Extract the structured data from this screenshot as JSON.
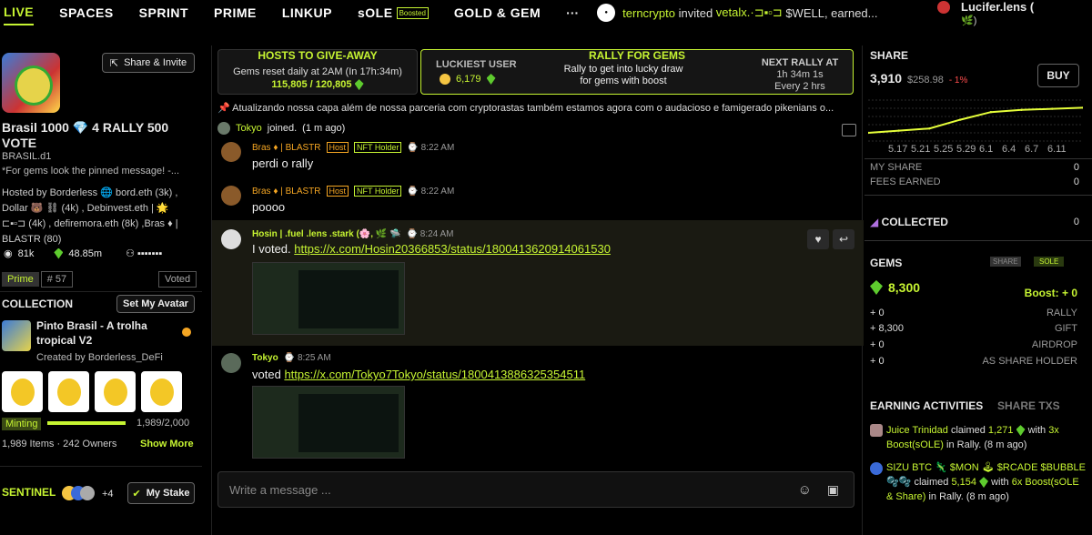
{
  "nav": {
    "tabs": [
      "LIVE",
      "SPACES",
      "SPRINT",
      "PRIME",
      "LINKUP",
      "sOLE",
      "GOLD & GEM"
    ],
    "boosted": "Boosted",
    "more": "···",
    "ticker_user": "terncrypto",
    "ticker_text": "invited",
    "ticker_target": "vetalx.·⊐▪▫⊐",
    "ticker_tail": "$WELL, earned...",
    "account_name": "Lucifer.lens (",
    "account_sub": "🌿)"
  },
  "room": {
    "share_invite": "Share & Invite",
    "title": "Brasil 1000 💎 4 RALLY 500 VOTE",
    "handle": "BRASIL.d1",
    "pinned": "*For gems look the pinned message! -...",
    "hosted_by": "Hosted by Borderless 🌐 bord.eth (3k) , Dollar 🐻 ⛓ (4k) , Debinvest.eth | 🌟 ⊏▪▫⊐ (4k) , defiremora.eth (8k) ,Bras ♦ | BLASTR (80)",
    "stat_members": "81k",
    "stat_gems": "48.85m",
    "prime": "Prime",
    "prime_rank": "# 57",
    "voted": "Voted"
  },
  "collection": {
    "heading": "COLLECTION",
    "set_avatar": "Set My Avatar",
    "name": "Pinto Brasil - A trolha tropical V2",
    "created_by": "Created by Borderless_DeFi",
    "minting": "Minting",
    "minted": "1,989/2,000",
    "progress": 0.9945,
    "items": "1,989",
    "items_label": "Items ·",
    "owners": "242",
    "owners_label": "Owners",
    "show_more": "Show More"
  },
  "sentinel": {
    "label": "SENTINEL",
    "count": "+4",
    "stake": "My Stake"
  },
  "banner": {
    "hosts_title": "HOSTS TO GIVE-AWAY",
    "hosts_reset": "Gems reset daily at 2AM (In 17h:34m)",
    "hosts_progress": "115,805 / 120,805",
    "luckiest_title": "LUCKIEST USER",
    "luckiest_value": "6,179",
    "rally_title": "RALLY FOR GEMS",
    "rally_text": "Rally to get into lucky draw for gems with boost",
    "next_rally_title": "NEXT RALLY AT",
    "next_rally_time": "1h 34m 1s",
    "next_rally_every": "Every 2 hrs"
  },
  "announcement": "Atualizando nossa capa além de nossa parceria com cryptorastas também estamos agora com o audacioso e famigerado pikenians o...",
  "joined": {
    "name": "Tokyo",
    "text": "joined.",
    "time": "(1 m ago)"
  },
  "messages": [
    {
      "name": "Bras ♦ | BLASTR",
      "host": "Host",
      "holder": "NFT Holder",
      "time": "8:22 AM",
      "text": "perdi o rally"
    },
    {
      "name": "Bras ♦ | BLASTR",
      "host": "Host",
      "holder": "NFT Holder",
      "time": "8:22 AM",
      "text": "poooo"
    },
    {
      "name": "Hosin | .fuel .lens .stark (🌸, 🌿 🛸",
      "time": "8:24 AM",
      "text": "I voted.",
      "link": "https://x.com/Hosin20366853/status/1800413620914061530"
    },
    {
      "name": "Tokyo",
      "time": "8:25 AM",
      "text": "voted",
      "link": "https://x.com/Tokyo7Tokyo/status/1800413886325354511"
    }
  ],
  "input_placeholder": "Write a message ...",
  "share": {
    "heading": "SHARE",
    "price": "3,910",
    "usd": "$258.98",
    "change": "- 1%",
    "buy": "BUY",
    "x_ticks": [
      "5.17",
      "5.21",
      "5.25",
      "5.29",
      "6.1",
      "6.4",
      "6.7",
      "6.11"
    ],
    "my_share_label": "MY SHARE",
    "my_share": "0",
    "fees_label": "FEES EARNED",
    "fees": "0"
  },
  "collected": {
    "label": "COLLECTED",
    "value": "0"
  },
  "gems": {
    "heading": "GEMS",
    "share_btn": "SHARE",
    "sole_btn": "SOLE",
    "value": "8,300",
    "boost": "Boost: + 0",
    "rows": [
      {
        "value": "+ 0",
        "label": "RALLY"
      },
      {
        "value": "+ 8,300",
        "label": "GIFT"
      },
      {
        "value": "+ 0",
        "label": "AIRDROP"
      },
      {
        "value": "+ 0",
        "label": "AS SHARE HOLDER"
      }
    ]
  },
  "earning": {
    "tab_active": "EARNING ACTIVITIES",
    "tab_other": "SHARE TXS",
    "a1_name": "Juice Trinidad",
    "a1_claimed": "claimed",
    "a1_amount": "1,271",
    "a1_with": "with",
    "a1_boost": "3x Boost(sOLE)",
    "a1_tail": "in Rally. (8 m ago)",
    "a2_name": "SIZU BTC 🦎 $MON 🕹 $RCADE $BUBBLE 🫧🫧",
    "a2_claimed": "claimed",
    "a2_amount": "5,154",
    "a2_with": "with",
    "a2_boost": "6x Boost(sOLE & Share)",
    "a2_tail": "in Rally. (8 m ago)"
  },
  "chart_data": {
    "type": "line",
    "x": [
      "5.17",
      "5.21",
      "5.25",
      "5.29",
      "6.1",
      "6.4",
      "6.7",
      "6.11"
    ],
    "series": [
      {
        "values": [
          20,
          24,
          28,
          44,
          58,
          62,
          64,
          66
        ]
      }
    ]
  }
}
